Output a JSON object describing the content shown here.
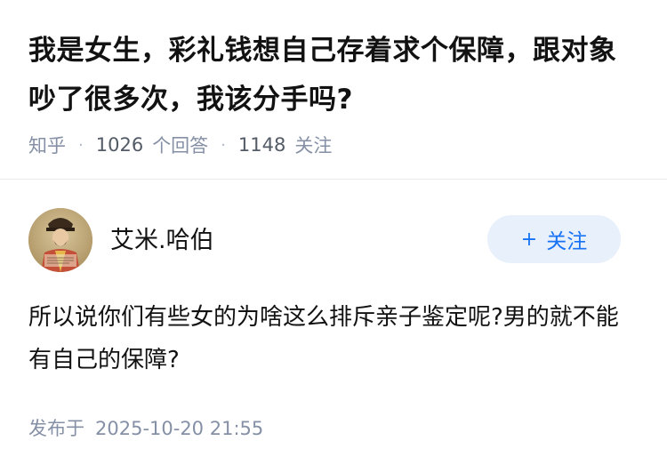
{
  "question": {
    "title": "我是女生，彩礼钱想自己存着求个保障，跟对象吵了很多次，我该分手吗?",
    "source": "知乎",
    "separator": "·",
    "answers_count": "1026",
    "answers_label": "个回答",
    "followers_count": "1148",
    "followers_label": "关注"
  },
  "answer": {
    "author": {
      "name": "艾米.哈伯",
      "avatar_icon": "avatar-portrait-icon"
    },
    "follow_button": {
      "icon": "plus-icon",
      "plus_symbol": "+",
      "label": "关注"
    },
    "content": "所以说你们有些女的为啥这么排斥亲子鉴定呢?男的就不能有自己的保障?",
    "publish": {
      "label": "发布于",
      "datetime": "2025-10-20 21:55"
    }
  },
  "colors": {
    "accent": "#1772f6",
    "follow_bg": "#e8f0fb",
    "meta_text": "#8590a6",
    "title_text": "#121212"
  }
}
